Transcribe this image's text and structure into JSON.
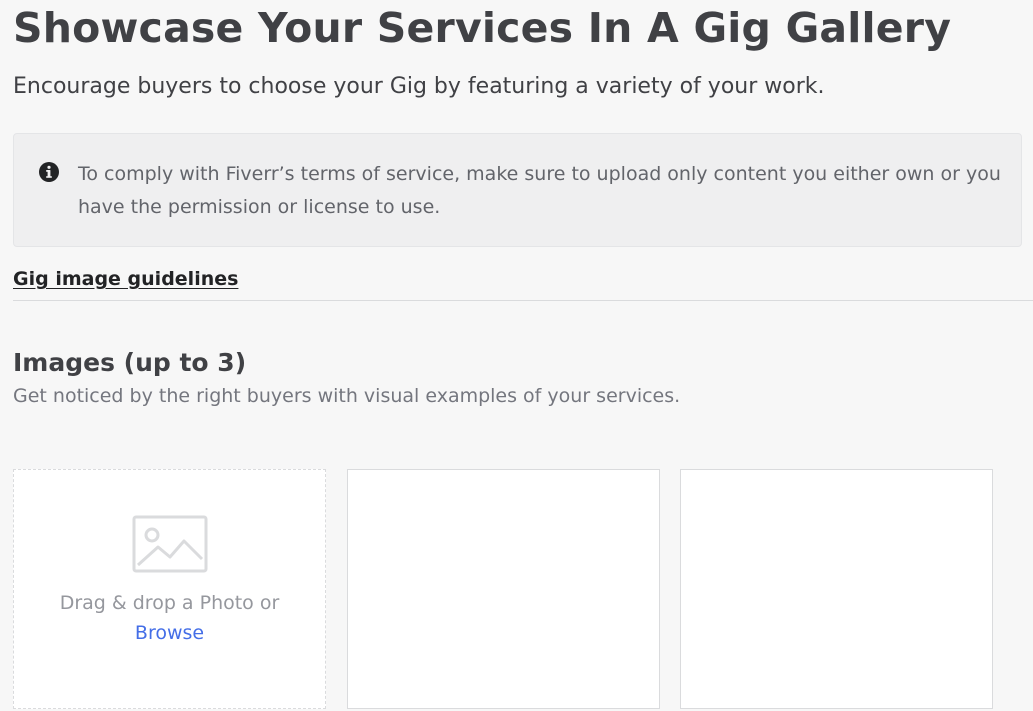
{
  "header": {
    "title": "Showcase Your Services In A Gig Gallery",
    "subtitle": "Encourage buyers to choose your Gig by featuring a variety of your work."
  },
  "notice": {
    "icon": "info-circle-icon",
    "text": "To comply with Fiverr’s terms of service, make sure to upload only content you either own or you have the permission or license to use."
  },
  "guidelines_link": "Gig image guidelines",
  "images_section": {
    "title": "Images (up to 3)",
    "subtitle": "Get noticed by the right buyers with visual examples of your services.",
    "upload": {
      "icon": "image-placeholder-icon",
      "drop_text": "Drag & drop a Photo or",
      "browse_label": "Browse"
    }
  },
  "colors": {
    "link_blue": "#446ee7",
    "text_dark": "#404145",
    "text_muted": "#74767e"
  }
}
